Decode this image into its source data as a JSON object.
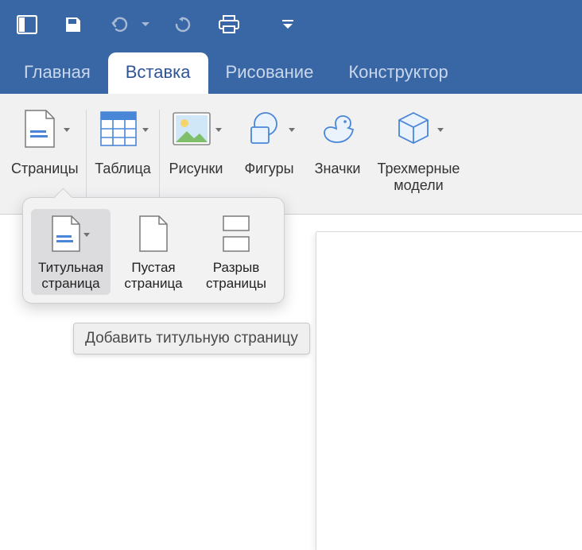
{
  "tabs": {
    "home": "Главная",
    "insert": "Вставка",
    "draw": "Рисование",
    "design": "Конструктор"
  },
  "ribbon": {
    "pages": "Страницы",
    "table": "Таблица",
    "pictures": "Рисунки",
    "shapes": "Фигуры",
    "icons": "Значки",
    "models3d_l1": "Трехмерные",
    "models3d_l2": "модели"
  },
  "dropdown": {
    "cover_l1": "Титульная",
    "cover_l2": "страница",
    "blank_l1": "Пустая",
    "blank_l2": "страница",
    "break_l1": "Разрыв",
    "break_l2": "страницы"
  },
  "tooltip": "Добавить титульную страницу"
}
